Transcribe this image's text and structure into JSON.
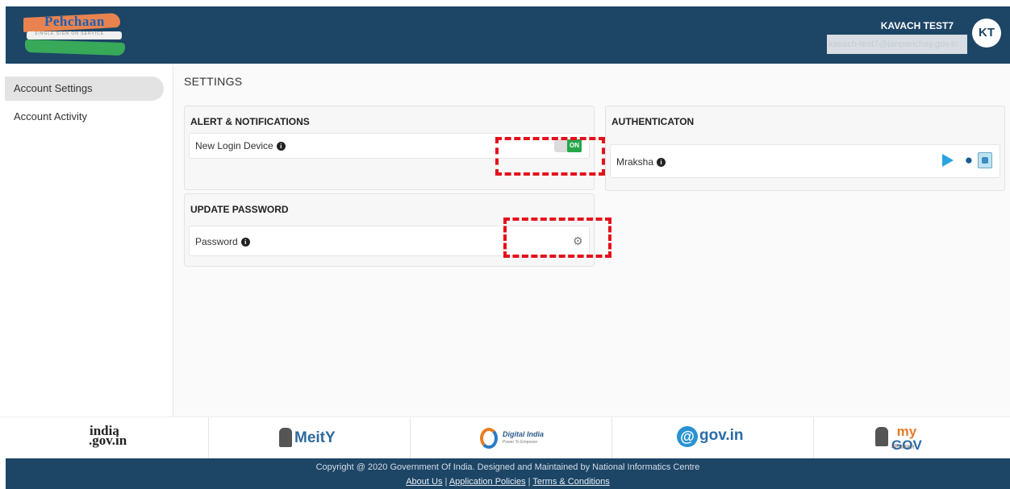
{
  "header": {
    "logo_text": "Pehchaan",
    "logo_tagline": "SINGLE SIGN ON SERVICE",
    "user_name": "KAVACH TEST7",
    "user_email": "kavach-test7@janparichay.gov.in",
    "avatar_initials": "KT"
  },
  "sidebar": {
    "items": [
      {
        "label": "Account Settings",
        "active": true
      },
      {
        "label": "Account Activity",
        "active": false
      }
    ]
  },
  "main": {
    "title": "SETTINGS",
    "alerts": {
      "title": "ALERT & NOTIFICATIONS",
      "new_login_label": "New Login Device",
      "toggle_state": "ON"
    },
    "password": {
      "title": "UPDATE PASSWORD",
      "password_label": "Password",
      "icon": "gear-icon"
    },
    "auth": {
      "title": "AUTHENTICATON",
      "app_label": "Mraksha",
      "icons": [
        "play-store-icon",
        "apple-icon",
        "app-download-icon"
      ]
    }
  },
  "footer": {
    "partners": {
      "india_gov_line1": "india",
      "india_gov_line2": ".gov.in",
      "meity": "MeitY",
      "digital_india": "Digital India",
      "digital_india_tagline": "Power To Empower",
      "gov_in": "gov.in",
      "mygov_my": "my",
      "mygov_gov": "GOV",
      "mygov_tagline": "मेरी सरकार"
    },
    "copyright": "Copyright @ 2020 Government Of India. Designed and Maintained by National Informatics Centre",
    "links": {
      "about": "About Us",
      "policies": "Application Policies",
      "terms": "Terms & Conditions"
    }
  },
  "colors": {
    "header_bg": "#1c4566",
    "toggle_on": "#25a74a",
    "highlight_dash": "#e4101b"
  }
}
